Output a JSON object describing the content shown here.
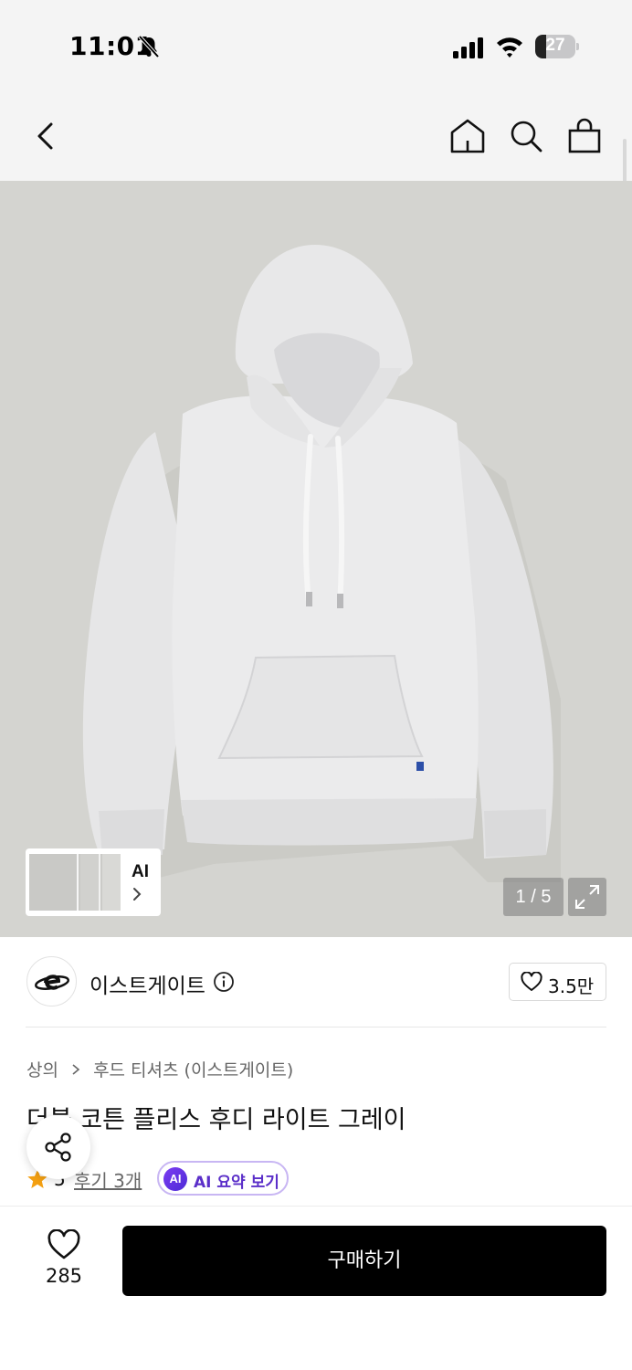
{
  "status_bar": {
    "time": "11:01",
    "battery_level": "27",
    "battery_percent": 27
  },
  "nav": {
    "icons": [
      "back-icon",
      "home-icon",
      "search-icon",
      "shopping-bag-icon"
    ]
  },
  "gallery": {
    "thumbnail_ai_label": "AI",
    "page_counter": "1 / 5",
    "current_page": 1,
    "total_pages": 5
  },
  "brand": {
    "name": "이스트게이트",
    "like_count": "3.5만"
  },
  "breadcrumb": {
    "category": "상의",
    "subcategory": "후드 티셔츠 (이스트게이트)"
  },
  "product": {
    "title": "더블 코튼 플리스 후디 라이트 그레이",
    "rating": "5",
    "review_link": "후기 3개",
    "ai_badge": "AI",
    "ai_summary_label": "AI 요약 보기"
  },
  "bottom_bar": {
    "wish_count": "285",
    "buy_label": "구매하기"
  },
  "colors": {
    "image_background": "#d4d4d0",
    "hoodie": "#e9e9ea",
    "buy_button": "#000000",
    "ai_accent": "#5b2fc9",
    "star": "#f4a012"
  }
}
